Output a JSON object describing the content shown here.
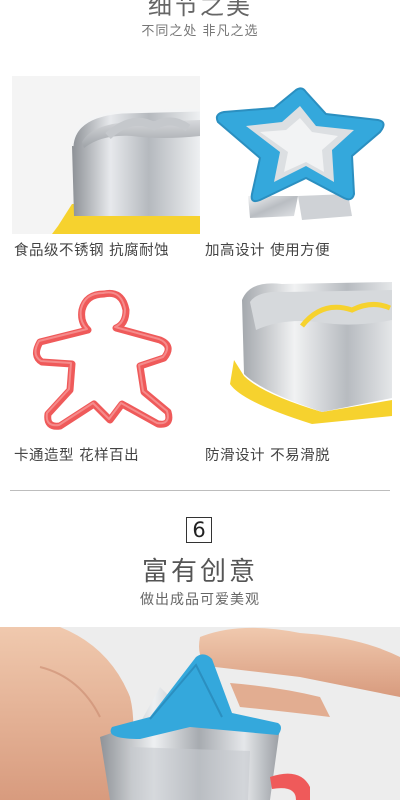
{
  "header": {
    "title": "细节之美",
    "subtitle": "不同之处 非凡之选"
  },
  "features": [
    {
      "caption": "食品级不锈钢 抗腐耐蚀",
      "image": "rounded-cutter-closeup"
    },
    {
      "caption": "加高设计 使用方便",
      "image": "blue-star-cutter"
    },
    {
      "caption": "卡通造型 花样百出",
      "image": "red-gingerbread-man-outline"
    },
    {
      "caption": "防滑设计 不易滑脱",
      "image": "yellow-heart-cutter-closeup"
    }
  ],
  "section6": {
    "number": "6",
    "title": "富有创意",
    "subtitle": "做出成品可爱美观"
  },
  "colors": {
    "steel": "#c9ccd0",
    "blue": "#34a8dc",
    "yellow": "#f6d22e",
    "red": "#ef5a5a",
    "skin": "#e8b79a"
  }
}
